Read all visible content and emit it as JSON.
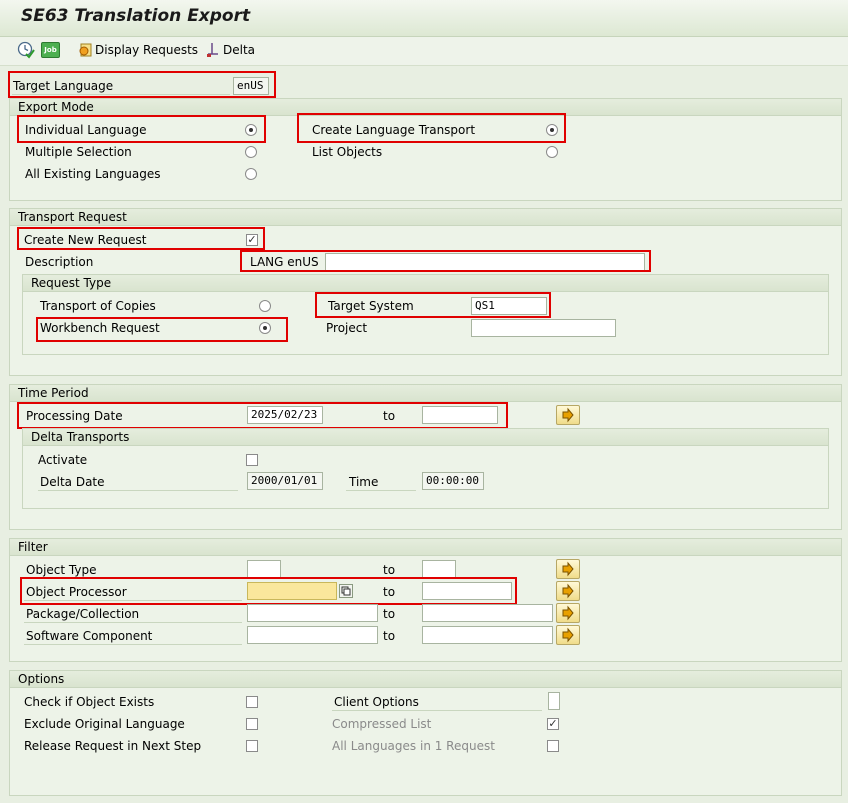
{
  "window": {
    "title": "SE63 Translation Export"
  },
  "toolbar": {
    "execute_icon": "execute-clock-icon",
    "job_icon": "job-icon",
    "display_requests_label": "Display Requests",
    "delta_label": "Delta",
    "job_text": "Job"
  },
  "target_language": {
    "label": "Target Language",
    "value": "enUS"
  },
  "export_mode": {
    "title": "Export Mode",
    "individual_language": "Individual Language",
    "multiple_selection": "Multiple Selection",
    "all_existing_languages": "All Existing Languages",
    "create_language_transport": "Create Language Transport",
    "list_objects": "List Objects",
    "selected_left": "Individual Language",
    "selected_right": "Create Language Transport"
  },
  "transport_request": {
    "title": "Transport Request",
    "create_new_request": "Create New Request",
    "create_new_checked": true,
    "description_label": "Description",
    "description_prefix": "LANG enUS",
    "description_value": "",
    "request_type": {
      "title": "Request Type",
      "transport_of_copies": "Transport of Copies",
      "workbench_request": "Workbench Request",
      "selected": "Workbench Request",
      "target_system_label": "Target System",
      "target_system_value": "QS1",
      "project_label": "Project",
      "project_value": ""
    }
  },
  "time_period": {
    "title": "Time Period",
    "processing_date_label": "Processing Date",
    "processing_date_from": "2025/02/23",
    "to_label": "to",
    "processing_date_to": "",
    "delta_transports": {
      "title": "Delta Transports",
      "activate_label": "Activate",
      "activate_checked": false,
      "delta_date_label": "Delta Date",
      "delta_date_value": "2000/01/01",
      "time_label": "Time",
      "time_value": "00:00:00"
    }
  },
  "filter": {
    "title": "Filter",
    "to_label": "to",
    "object_type_label": "Object Type",
    "object_processor_label": "Object Processor",
    "package_label": "Package/Collection",
    "software_component_label": "Software Component"
  },
  "options": {
    "title": "Options",
    "check_object_exists": "Check if Object Exists",
    "exclude_original_language": "Exclude Original Language",
    "release_request_next_step": "Release Request in Next Step",
    "client_options": "Client Options",
    "compressed_list": "Compressed List",
    "compressed_list_checked": true,
    "all_languages_one_request": "All Languages in 1 Request"
  },
  "colors": {
    "highlight_border": "#e00000",
    "required_field": "#fae79c",
    "background": "#e8efe2"
  }
}
